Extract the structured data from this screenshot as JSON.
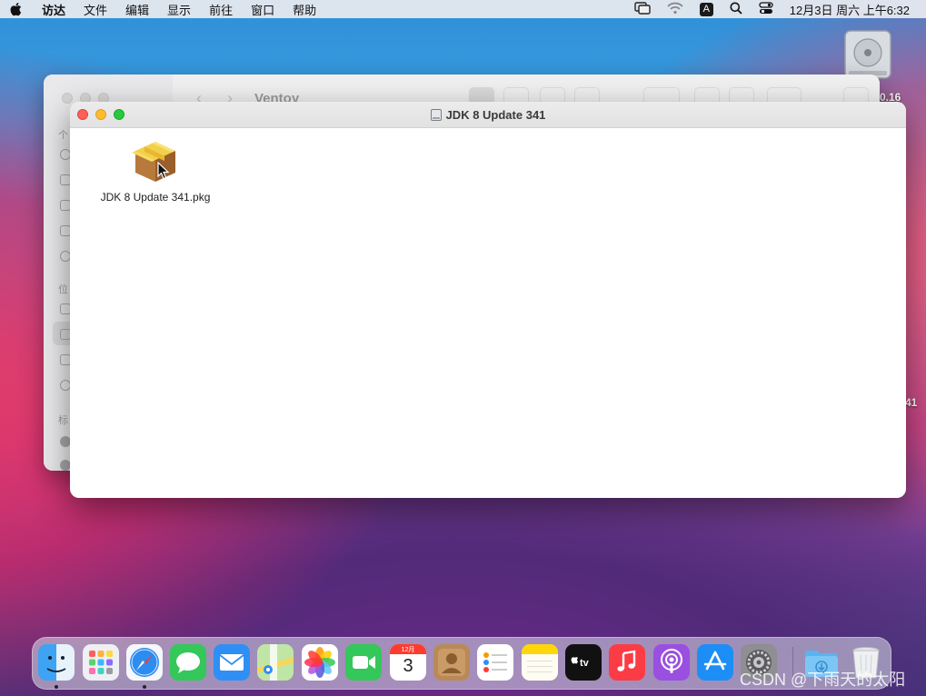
{
  "menubar": {
    "app_name": "访达",
    "items": [
      "文件",
      "编辑",
      "显示",
      "前往",
      "窗口",
      "帮助"
    ],
    "input_method": "A",
    "clock": "12月3日 周六 上午6:32"
  },
  "desktop": {
    "disk_label": "0.16",
    "side_label": "41"
  },
  "back_window": {
    "title": "Ventoy",
    "sidebar_headings": [
      "个",
      "位",
      "标"
    ]
  },
  "front_window": {
    "title": "JDK 8 Update 341",
    "file": {
      "name": "JDK 8 Update 341.pkg",
      "icon": "package-icon"
    }
  },
  "dock": {
    "calendar_month": "12月",
    "calendar_day": "3",
    "apps": [
      "finder",
      "launchpad",
      "safari",
      "messages",
      "mail",
      "maps",
      "photos",
      "facetime",
      "calendar",
      "contacts",
      "reminders",
      "notes",
      "apple-tv",
      "music",
      "podcasts",
      "app-store",
      "system-preferences",
      "downloads",
      "trash"
    ]
  },
  "watermark": "CSDN @下雨天的太阳"
}
